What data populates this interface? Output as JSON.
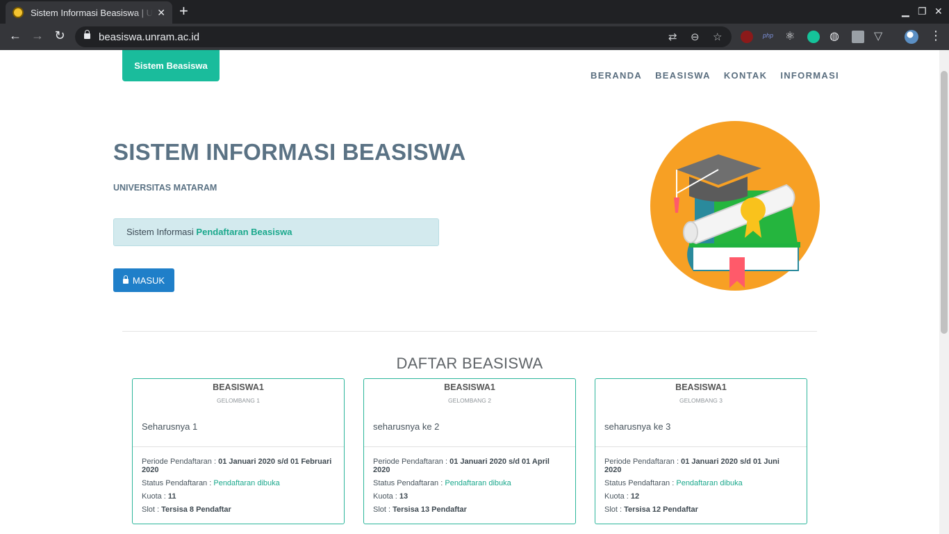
{
  "browser": {
    "tab_title": "Sistem Informasi Beasiswa | UNRAM",
    "url": "beasiswa.unram.ac.id",
    "window_controls": [
      "minimize-icon",
      "maximize-icon",
      "close-icon"
    ],
    "nav_icons": [
      "back-arrow-icon",
      "forward-arrow-icon",
      "reload-icon"
    ],
    "omnibox_icons": [
      "translate-icon",
      "zoom-out-icon",
      "bookmark-star-icon"
    ],
    "extensions": [
      "ublock-icon",
      "php-icon",
      "react-devtools-icon",
      "grammarly-icon",
      "globe-icon",
      "image-extension-icon",
      "vue-devtools-icon"
    ],
    "extension_php_label": "php"
  },
  "site": {
    "brand": "Sistem Beasiswa",
    "nav": [
      "BERANDA",
      "BEASISWA",
      "KONTAK",
      "INFORMASI"
    ]
  },
  "hero": {
    "title": "SISTEM INFORMASI BEASISWA",
    "subtitle": "UNIVERSITAS MATARAM",
    "info_prefix": "Sistem Informasi ",
    "info_highlight": "Pendaftaran Beasiswa",
    "login_label": "MASUK"
  },
  "section": {
    "title": "DAFTAR BEASISWA"
  },
  "labels": {
    "period": "Periode Pendaftaran : ",
    "status": "Status Pendaftaran : ",
    "quota": "Kuota : ",
    "slot": "Slot : "
  },
  "scholarships": [
    {
      "name": "BEASISWA1",
      "wave": "GELOMBANG 1",
      "description": "Seharusnya 1",
      "period": "01 Januari 2020 s/d 01 Februari 2020",
      "status": "Pendaftaran dibuka",
      "quota": "11",
      "slot": "Tersisa 8 Pendaftar"
    },
    {
      "name": "BEASISWA1",
      "wave": "GELOMBANG 2",
      "description": "seharusnya ke 2",
      "period": "01 Januari 2020 s/d 01 April 2020",
      "status": "Pendaftaran dibuka",
      "quota": "13",
      "slot": "Tersisa 13 Pendaftar"
    },
    {
      "name": "BEASISWA1",
      "wave": "GELOMBANG 3",
      "description": "seharusnya ke 3",
      "period": "01 Januari 2020 s/d 01 Juni 2020",
      "status": "Pendaftaran dibuka",
      "quota": "12",
      "slot": "Tersisa 12 Pendaftar"
    }
  ],
  "colors": {
    "accent": "#1abc9c",
    "primary_button": "#1f7fc9",
    "title_text": "#5a7284",
    "info_bg": "#d3eaee",
    "card_border": "#2bb59a",
    "illustration_circle": "#f7a024"
  }
}
